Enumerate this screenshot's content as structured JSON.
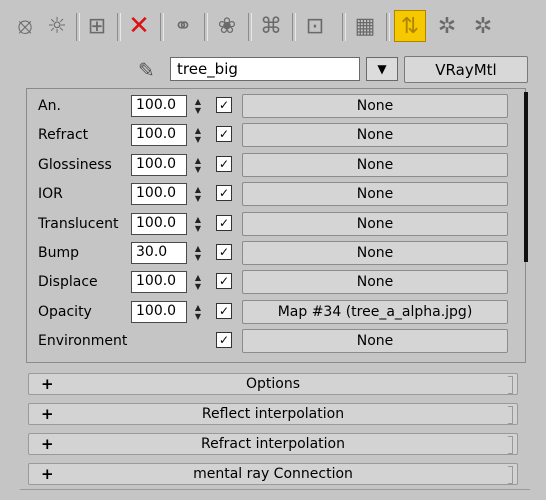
{
  "toolbar": {
    "icons": [
      "get-material-icon",
      "put-to-scene-icon",
      "assign-material-icon",
      "delete-icon",
      "make-unique-icon",
      "put-to-library-icon",
      "material-effects-channel-icon",
      "show-in-viewport-icon",
      "show-end-result-icon",
      "go-to-parent-icon",
      "go-forward-sibling-icon",
      "navigate-icon"
    ]
  },
  "material": {
    "name": "tree_big",
    "type": "VRayMtl",
    "dropdown_arrow": "▼"
  },
  "maps": [
    {
      "label": "An.",
      "amount": "100.0",
      "enabled": true,
      "map": "None"
    },
    {
      "label": "Refract",
      "amount": "100.0",
      "enabled": true,
      "map": "None"
    },
    {
      "label": "Glossiness",
      "amount": "100.0",
      "enabled": true,
      "map": "None"
    },
    {
      "label": "IOR",
      "amount": "100.0",
      "enabled": true,
      "map": "None"
    },
    {
      "label": "Translucent",
      "amount": "100.0",
      "enabled": true,
      "map": "None"
    },
    {
      "label": "Bump",
      "amount": "30.0",
      "enabled": true,
      "map": "None"
    },
    {
      "label": "Displace",
      "amount": "100.0",
      "enabled": true,
      "map": "None"
    },
    {
      "label": "Opacity",
      "amount": "100.0",
      "enabled": true,
      "map": "Map #34 (tree_a_alpha.jpg)"
    },
    {
      "label": "Environment",
      "amount": "",
      "enabled": true,
      "map": "None"
    }
  ],
  "rollouts": [
    {
      "sign": "+",
      "title": "Options"
    },
    {
      "sign": "+",
      "title": "Reflect interpolation"
    },
    {
      "sign": "+",
      "title": "Refract interpolation"
    },
    {
      "sign": "+",
      "title": "mental ray Connection"
    }
  ],
  "colors": {
    "active_toggle": "#f6c800",
    "delete_red": "#dd1111",
    "background": "#c5c5c5"
  }
}
